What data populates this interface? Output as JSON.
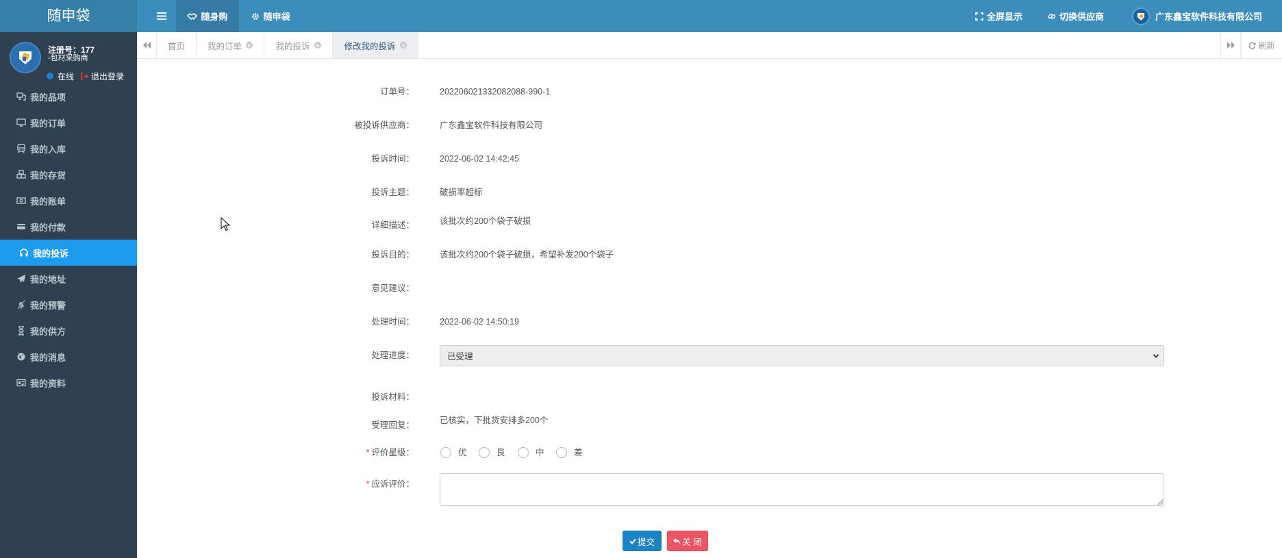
{
  "app": {
    "logo": "随申袋"
  },
  "header": {
    "nav": [
      {
        "label": "随身购",
        "icon": "handshake-icon",
        "active": true
      },
      {
        "label": "随申袋",
        "icon": "gear-icon",
        "active": false
      }
    ],
    "fullscreen": {
      "label": "全屏显示",
      "icon": "expand-icon"
    },
    "switch_supplier": {
      "label": "切换供应商",
      "icon": "link-icon"
    },
    "company": {
      "name": "广东鑫宝软件科技有限公司"
    }
  },
  "user": {
    "reg_no": "注册号：177",
    "role": "-包材采购商",
    "status": "在线",
    "logout": "退出登录"
  },
  "sidebar": {
    "active_index": 6,
    "items": [
      {
        "label": "我的品项",
        "icon": "sitemap-icon"
      },
      {
        "label": "我的订单",
        "icon": "desktop-icon"
      },
      {
        "label": "我的入库",
        "icon": "bus-icon"
      },
      {
        "label": "我的存货",
        "icon": "cubes-icon"
      },
      {
        "label": "我的账单",
        "icon": "money-icon"
      },
      {
        "label": "我的付款",
        "icon": "credit-card-icon"
      },
      {
        "label": "我的投诉",
        "icon": "headphones-icon"
      },
      {
        "label": "我的地址",
        "icon": "paper-plane-icon"
      },
      {
        "label": "我的预警",
        "icon": "bell-slash-icon"
      },
      {
        "label": "我的供方",
        "icon": "hourglass-icon"
      },
      {
        "label": "我的消息",
        "icon": "globe-icon"
      },
      {
        "label": "我的资料",
        "icon": "id-card-icon"
      }
    ]
  },
  "tabs": {
    "active_index": 3,
    "items": [
      {
        "label": "首页",
        "closable": false
      },
      {
        "label": "我的订单",
        "closable": true
      },
      {
        "label": "我的投诉",
        "closable": true
      },
      {
        "label": "修改我的投诉",
        "closable": true
      }
    ],
    "refresh": "刷新"
  },
  "form": {
    "order_no": {
      "label": "订单号：",
      "value": "202206021332082088-990-1"
    },
    "supplier": {
      "label": "被投诉供应商：",
      "value": "广东鑫宝软件科技有限公司"
    },
    "complaint_time": {
      "label": "投诉时间：",
      "value": "2022-06-02 14:42:45"
    },
    "subject": {
      "label": "投诉主题：",
      "value": "破损率超标"
    },
    "description": {
      "label": "详细描述：",
      "value": "该批次约200个袋子破损"
    },
    "purpose": {
      "label": "投诉目的：",
      "value": "该批次约200个袋子破损，希望补发200个袋子"
    },
    "suggestion": {
      "label": "意见建议：",
      "value": ""
    },
    "handle_time": {
      "label": "处理时间：",
      "value": "2022-06-02 14:50:19"
    },
    "progress": {
      "label": "处理进度：",
      "selected": "已受理"
    },
    "materials": {
      "label": "投诉材料：",
      "value": ""
    },
    "reply": {
      "label": "受理回复：",
      "value": "已核实，下批货安排多200个"
    },
    "rating": {
      "label": "评价星级：",
      "required_mark": "*",
      "options": [
        "优",
        "良",
        "中",
        "差"
      ],
      "selected": null
    },
    "evaluation": {
      "label": "应诉评价：",
      "required_mark": "*",
      "value": ""
    },
    "submit": {
      "label": "提交",
      "icon": "check-icon"
    },
    "close": {
      "label": "关 闭",
      "icon": "reply-icon"
    }
  },
  "colors": {
    "header": "#3c8dbc",
    "logo_bg": "#367fa9",
    "sidebar": "#2f4050",
    "active_menu": "#1c9bef",
    "submit": "#1c84c6",
    "close": "#ed5565",
    "required": "#e4393c"
  }
}
